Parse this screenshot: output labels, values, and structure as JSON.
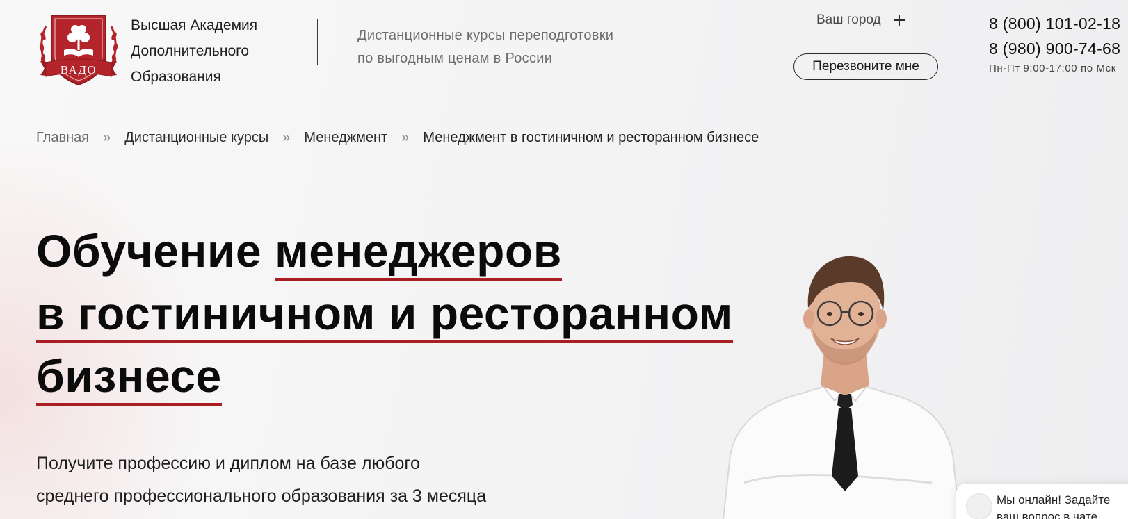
{
  "header": {
    "logo_text": "ВАДО",
    "org_name": [
      "Высшая Академия",
      "Дополнительного",
      "Образования"
    ],
    "tagline": [
      "Дистанционные курсы переподготовки",
      "по выгодным ценам в России"
    ],
    "city_label": "Ваш город",
    "callback_label": "Перезвоните мне",
    "phones": [
      "8 (800) 101-02-18",
      "8 (980) 900-74-68"
    ],
    "hours": "Пн-Пт 9:00-17:00 по Мск"
  },
  "breadcrumb": {
    "items": [
      "Главная",
      "Дистанционные курсы",
      "Менеджмент"
    ],
    "separator": "»",
    "current": "Менеджмент в гостиничном и ресторанном бизнесе"
  },
  "hero": {
    "title_line1_plain": "Обучение ",
    "title_line1_hl": "менеджеров",
    "title_line2": "в гостиничном и ресторанном",
    "title_line3": "бизнесе",
    "subtitle": [
      "Получите профессию и диплом на базе любого",
      "среднего профессионального образования за 3 месяца"
    ]
  },
  "chat": {
    "lines": [
      "Мы онлайн! Задайте",
      "ваш вопрос в чате"
    ]
  },
  "colors": {
    "accent": "#a81e22",
    "logo_red": "#b3242b",
    "text": "#0b0b0b"
  },
  "icons": {
    "city_toggle": "plus-icon",
    "logo": "academy-crest-logo",
    "chat": "chat-avatar-icon"
  }
}
